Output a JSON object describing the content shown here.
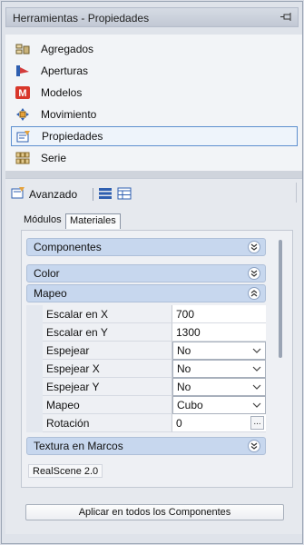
{
  "window": {
    "title": "Herramientas - Propiedades"
  },
  "tools": [
    {
      "label": "Agregados",
      "icon": "aggregates-icon"
    },
    {
      "label": "Aperturas",
      "icon": "openings-icon"
    },
    {
      "label": "Modelos",
      "icon": "models-icon"
    },
    {
      "label": "Movimiento",
      "icon": "move-icon"
    },
    {
      "label": "Propiedades",
      "icon": "properties-icon",
      "selected": true
    },
    {
      "label": "Serie",
      "icon": "series-icon"
    }
  ],
  "subtoolbar": {
    "advanced_label": "Avanzado"
  },
  "tabs": [
    {
      "label": "Módulos",
      "active": false
    },
    {
      "label": "Materiales",
      "active": true
    }
  ],
  "sections": {
    "componentes": "Componentes",
    "color": "Color",
    "mapeo": "Mapeo",
    "textura": "Textura en Marcos"
  },
  "properties": [
    {
      "key": "Escalar en X",
      "value": "700",
      "type": "text"
    },
    {
      "key": "Escalar en Y",
      "value": "1300",
      "type": "text"
    },
    {
      "key": "Espejear",
      "value": "No",
      "type": "dropdown"
    },
    {
      "key": "Espejear X",
      "value": "No",
      "type": "dropdown"
    },
    {
      "key": "Espejear Y",
      "value": "No",
      "type": "dropdown"
    },
    {
      "key": "Mapeo",
      "value": "Cubo",
      "type": "dropdown"
    },
    {
      "key": "Rotación",
      "value": "0",
      "type": "ellipsis",
      "button": "..."
    }
  ],
  "footer_label": "RealScene 2.0",
  "apply_button": "Aplicar en todos los Componentes",
  "colors": {
    "section_header": "#c7d7ee",
    "selection_border": "#5d8fcf"
  }
}
